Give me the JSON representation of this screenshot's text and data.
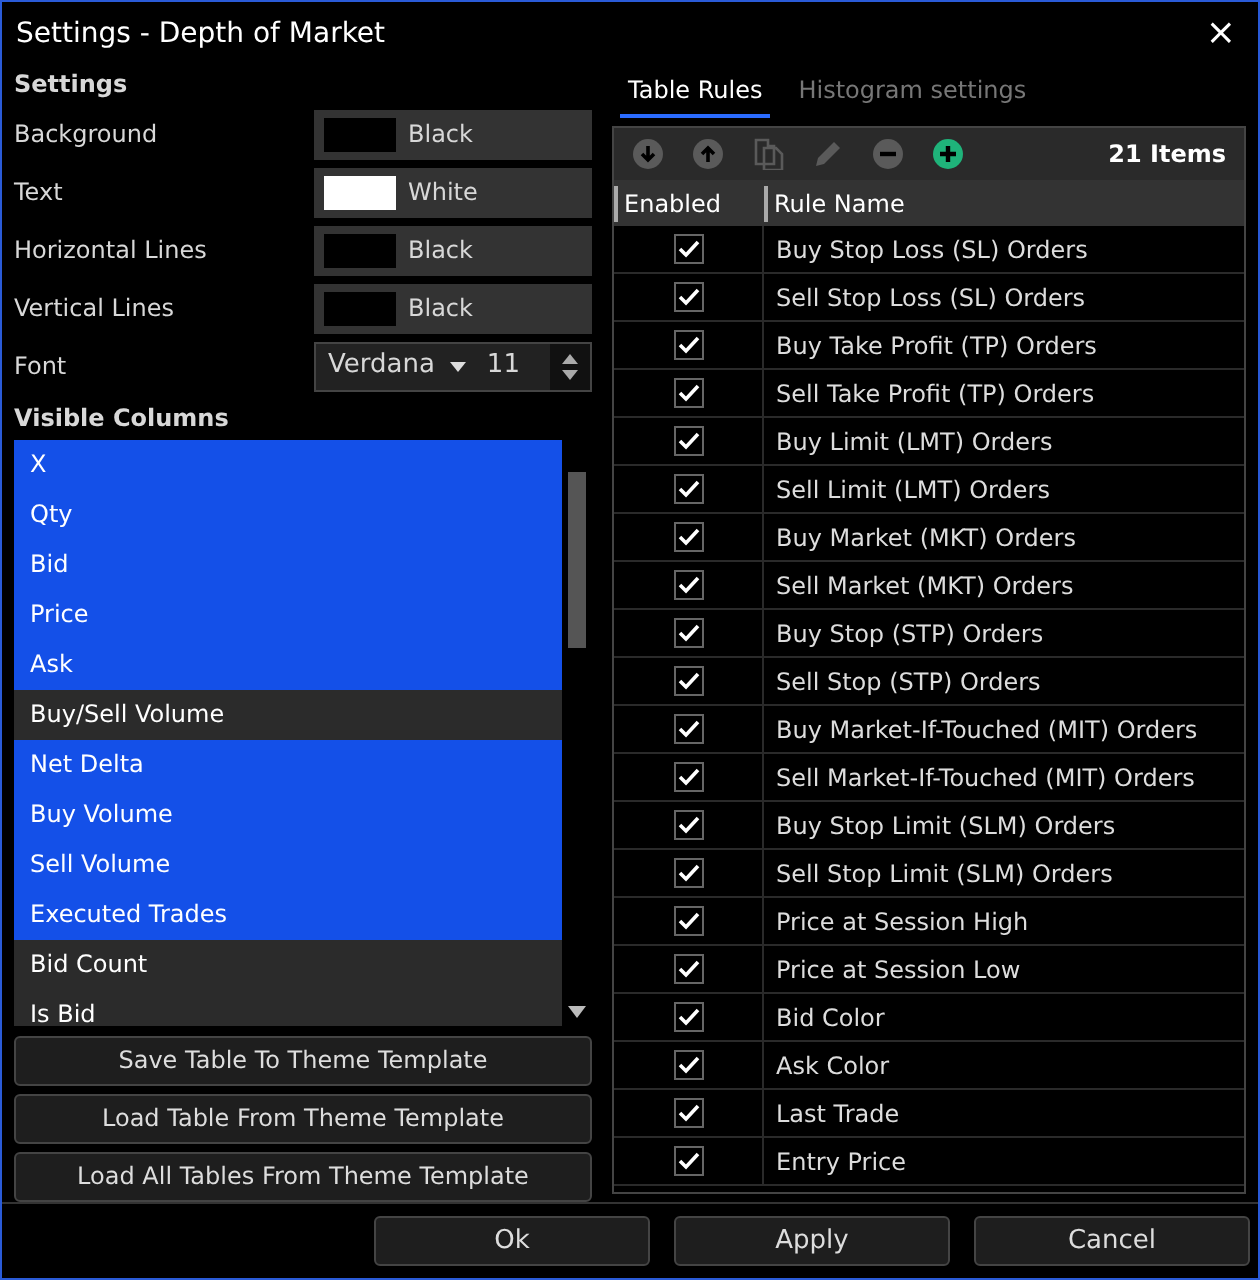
{
  "window": {
    "title": "Settings - Depth of Market",
    "close": "×"
  },
  "settings": {
    "heading": "Settings",
    "rows": [
      {
        "kind": "color",
        "label": "Background",
        "value": "Black",
        "color": "#000000"
      },
      {
        "kind": "color",
        "label": "Text",
        "value": "White",
        "color": "#ffffff"
      },
      {
        "kind": "color",
        "label": "Horizontal Lines",
        "value": "Black",
        "color": "#000000"
      },
      {
        "kind": "color",
        "label": "Vertical Lines",
        "value": "Black",
        "color": "#000000"
      },
      {
        "kind": "font",
        "label": "Font",
        "value": "Verdana",
        "size": "11"
      }
    ]
  },
  "visible_columns": {
    "heading": "Visible Columns",
    "items": [
      {
        "label": "X",
        "selected": true
      },
      {
        "label": "Qty",
        "selected": true
      },
      {
        "label": "Bid",
        "selected": true
      },
      {
        "label": "Price",
        "selected": true
      },
      {
        "label": "Ask",
        "selected": true
      },
      {
        "label": "Buy/Sell Volume",
        "selected": false
      },
      {
        "label": "Net Delta",
        "selected": true
      },
      {
        "label": "Buy Volume",
        "selected": true
      },
      {
        "label": "Sell Volume",
        "selected": true
      },
      {
        "label": "Executed Trades",
        "selected": true
      },
      {
        "label": "Bid Count",
        "selected": false
      },
      {
        "label": "Is Bid",
        "selected": false
      }
    ]
  },
  "template_buttons": [
    "Save Table To Theme Template",
    "Load Table From Theme Template",
    "Load All Tables From Theme Template"
  ],
  "tabs": [
    {
      "label": "Table Rules",
      "selected": true
    },
    {
      "label": "Histogram settings",
      "selected": false
    }
  ],
  "toolbar": {
    "tools": [
      {
        "kind": "down",
        "disabled": true
      },
      {
        "kind": "up",
        "disabled": true
      },
      {
        "kind": "copy",
        "disabled": true
      },
      {
        "kind": "edit",
        "disabled": true
      },
      {
        "kind": "remove",
        "disabled": true
      },
      {
        "kind": "add",
        "disabled": false
      }
    ],
    "count": "21 Items"
  },
  "table": {
    "columns": [
      "Enabled",
      "Rule Name"
    ],
    "rows": [
      {
        "enabled": true,
        "name": "Buy Stop Loss (SL) Orders"
      },
      {
        "enabled": true,
        "name": "Sell Stop Loss (SL) Orders"
      },
      {
        "enabled": true,
        "name": "Buy Take Profit (TP) Orders"
      },
      {
        "enabled": true,
        "name": "Sell Take Profit (TP) Orders"
      },
      {
        "enabled": true,
        "name": "Buy Limit (LMT) Orders"
      },
      {
        "enabled": true,
        "name": "Sell Limit (LMT) Orders"
      },
      {
        "enabled": true,
        "name": "Buy Market (MKT) Orders"
      },
      {
        "enabled": true,
        "name": "Sell Market (MKT) Orders"
      },
      {
        "enabled": true,
        "name": "Buy Stop (STP) Orders"
      },
      {
        "enabled": true,
        "name": "Sell Stop (STP) Orders"
      },
      {
        "enabled": true,
        "name": "Buy Market-If-Touched (MIT) Orders"
      },
      {
        "enabled": true,
        "name": "Sell Market-If-Touched (MIT) Orders"
      },
      {
        "enabled": true,
        "name": "Buy Stop Limit (SLM) Orders"
      },
      {
        "enabled": true,
        "name": "Sell Stop Limit (SLM) Orders"
      },
      {
        "enabled": true,
        "name": "Price at Session High"
      },
      {
        "enabled": true,
        "name": "Price at Session Low"
      },
      {
        "enabled": true,
        "name": "Bid Color"
      },
      {
        "enabled": true,
        "name": "Ask Color"
      },
      {
        "enabled": true,
        "name": "Last Trade"
      },
      {
        "enabled": true,
        "name": "Entry Price"
      }
    ]
  },
  "footer_buttons": [
    "Ok",
    "Apply",
    "Cancel"
  ]
}
